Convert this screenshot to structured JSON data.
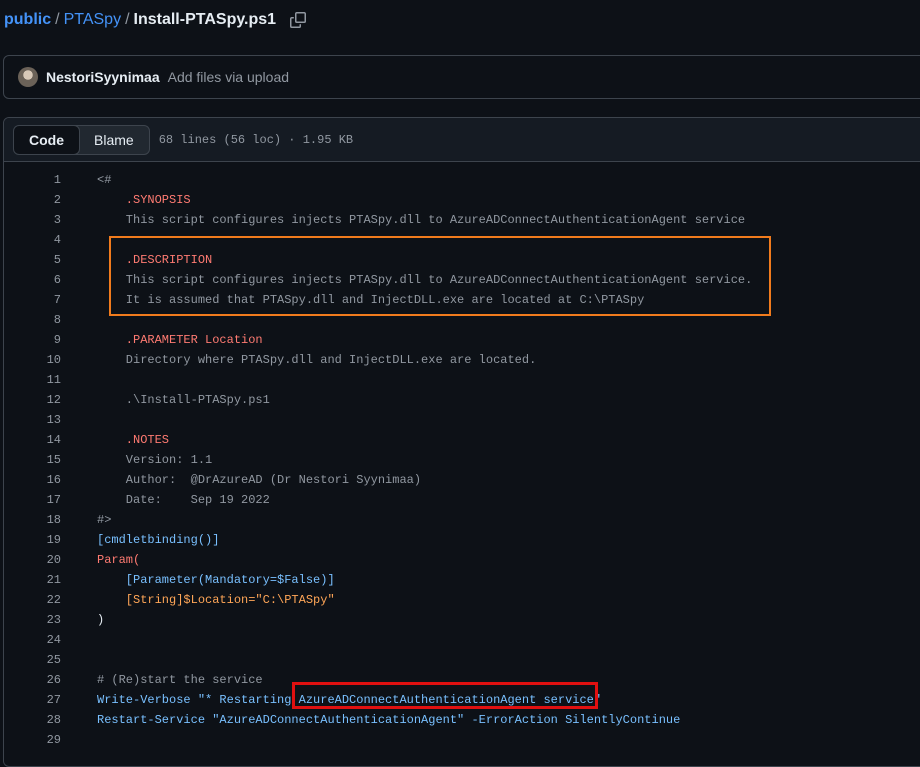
{
  "breadcrumb": {
    "org": "public",
    "sep1": "/",
    "repo": "PTASpy",
    "sep2": "/",
    "file": "Install-PTASpy.ps1"
  },
  "commit": {
    "author": "NestoriSyynimaa",
    "message": "Add files via upload"
  },
  "file_header": {
    "tab_code": "Code",
    "tab_blame": "Blame",
    "meta": "68 lines (56 loc) · 1.95 KB"
  },
  "icons": {
    "copy": "copy-icon",
    "avatar": "avatar"
  },
  "colors": {
    "highlight_description": "#f07b1d",
    "highlight_service": "#e01010",
    "link": "#4493f8"
  },
  "code_lines": [
    {
      "n": "1",
      "t": "<#"
    },
    {
      "n": "2",
      "t": "    .SYNOPSIS"
    },
    {
      "n": "3",
      "t": "    This script configures injects PTASpy.dll to AzureADConnectAuthenticationAgent service"
    },
    {
      "n": "4",
      "t": ""
    },
    {
      "n": "5",
      "t": "    .DESCRIPTION"
    },
    {
      "n": "6",
      "t": "    This script configures injects PTASpy.dll to AzureADConnectAuthenticationAgent service."
    },
    {
      "n": "7",
      "t": "    It is assumed that PTASpy.dll and InjectDLL.exe are located at C:\\PTASpy"
    },
    {
      "n": "8",
      "t": ""
    },
    {
      "n": "9",
      "t": "    .PARAMETER Location"
    },
    {
      "n": "10",
      "t": "    Directory where PTASpy.dll and InjectDLL.exe are located."
    },
    {
      "n": "11",
      "t": ""
    },
    {
      "n": "12",
      "t": "    .\\Install-PTASpy.ps1"
    },
    {
      "n": "13",
      "t": ""
    },
    {
      "n": "14",
      "t": "    .NOTES"
    },
    {
      "n": "15",
      "t": "    Version: 1.1"
    },
    {
      "n": "16",
      "t": "    Author:  @DrAzureAD (Dr Nestori Syynimaa)"
    },
    {
      "n": "17",
      "t": "    Date:    Sep 19 2022"
    },
    {
      "n": "18",
      "t": "#>"
    },
    {
      "n": "19",
      "t": "[cmdletbinding()]"
    },
    {
      "n": "20",
      "t": "Param("
    },
    {
      "n": "21",
      "t": "    [Parameter(Mandatory=$False)]"
    },
    {
      "n": "22",
      "t": "    [String]$Location=\"C:\\PTASpy\""
    },
    {
      "n": "23",
      "t": ")"
    },
    {
      "n": "24",
      "t": ""
    },
    {
      "n": "25",
      "t": ""
    },
    {
      "n": "26",
      "t": "# (Re)start the service"
    },
    {
      "n": "27",
      "t": "Write-Verbose \"* Restarting AzureADConnectAuthenticationAgent service\""
    },
    {
      "n": "28",
      "t": "Restart-Service \"AzureADConnectAuthenticationAgent\" -ErrorAction SilentlyContinue"
    },
    {
      "n": "29",
      "t": ""
    }
  ]
}
